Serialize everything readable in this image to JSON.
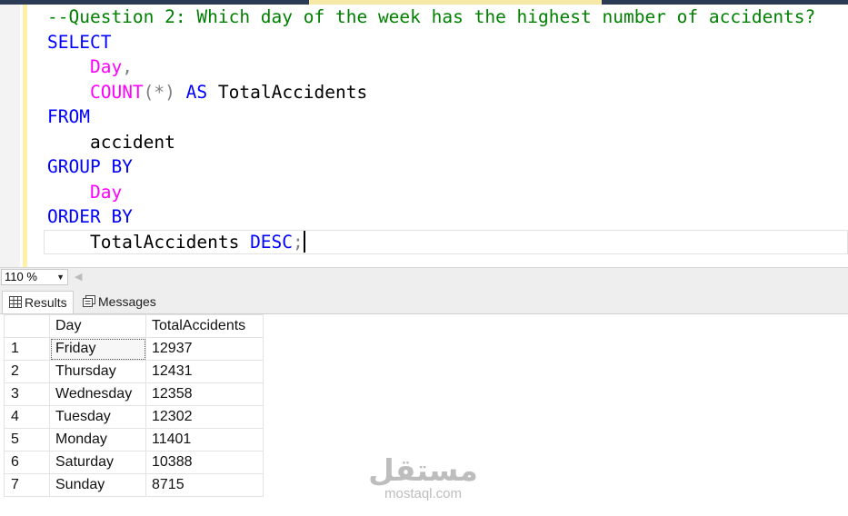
{
  "editor": {
    "lines": [
      [
        {
          "t": "--Question 2: Which day of the week has the highest number of accidents?",
          "c": "c-com"
        }
      ],
      [
        {
          "t": "SELECT",
          "c": "c-kw"
        }
      ],
      [
        {
          "t": "    "
        },
        {
          "t": "Day",
          "c": "c-fn"
        },
        {
          "t": ",",
          "c": "c-op"
        }
      ],
      [
        {
          "t": "    "
        },
        {
          "t": "COUNT",
          "c": "c-fn"
        },
        {
          "t": "(*)",
          "c": "c-op"
        },
        {
          "t": " "
        },
        {
          "t": "AS",
          "c": "c-kw"
        },
        {
          "t": " TotalAccidents",
          "c": "c-id"
        }
      ],
      [
        {
          "t": "FROM",
          "c": "c-kw"
        }
      ],
      [
        {
          "t": "    accident",
          "c": "c-id"
        }
      ],
      [
        {
          "t": "GROUP BY",
          "c": "c-kw"
        }
      ],
      [
        {
          "t": "    "
        },
        {
          "t": "Day",
          "c": "c-fn"
        }
      ],
      [
        {
          "t": "ORDER BY",
          "c": "c-kw"
        }
      ],
      [
        {
          "t": "    TotalAccidents ",
          "c": "c-id"
        },
        {
          "t": "DESC",
          "c": "c-kw"
        },
        {
          "t": ";",
          "c": "c-op"
        }
      ]
    ]
  },
  "zoom": {
    "value": "110 %"
  },
  "result_tabs": {
    "results": "Results",
    "messages": "Messages"
  },
  "grid": {
    "columns": [
      "Day",
      "TotalAccidents"
    ],
    "rows": [
      {
        "n": "1",
        "day": "Friday",
        "total": "12937"
      },
      {
        "n": "2",
        "day": "Thursday",
        "total": "12431"
      },
      {
        "n": "3",
        "day": "Wednesday",
        "total": "12358"
      },
      {
        "n": "4",
        "day": "Tuesday",
        "total": "12302"
      },
      {
        "n": "5",
        "day": "Monday",
        "total": "11401"
      },
      {
        "n": "6",
        "day": "Saturday",
        "total": "10388"
      },
      {
        "n": "7",
        "day": "Sunday",
        "total": "8715"
      }
    ]
  },
  "watermark": {
    "arabic": "مستقل",
    "latin": "mostaql.com"
  }
}
